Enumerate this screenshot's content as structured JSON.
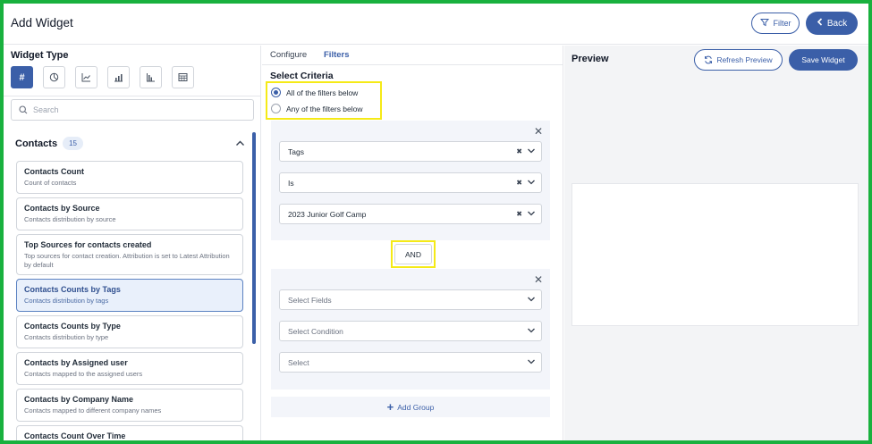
{
  "header": {
    "title": "Add Widget",
    "filter_label": "Filter",
    "back_label": "Back"
  },
  "left_panel": {
    "widget_type_label": "Widget Type",
    "type_icons": [
      "number-icon",
      "pie-chart-icon",
      "line-chart-icon",
      "bar-chart-icon",
      "column-chart-icon",
      "table-icon"
    ],
    "active_type_symbol": "#",
    "search_placeholder": "Search",
    "section": {
      "name": "Contacts",
      "count": "15"
    },
    "widgets": [
      {
        "title": "Contacts Count",
        "desc": "Count of contacts",
        "selected": false
      },
      {
        "title": "Contacts by Source",
        "desc": "Contacts distribution by source",
        "selected": false
      },
      {
        "title": "Top Sources for contacts created",
        "desc": "Top sources for contact creation. Attribution is set to Latest Attribution by default",
        "selected": false
      },
      {
        "title": "Contacts Counts by Tags",
        "desc": "Contacts distribution by tags",
        "selected": true
      },
      {
        "title": "Contacts Counts by Type",
        "desc": "Contacts distribution by type",
        "selected": false
      },
      {
        "title": "Contacts by Assigned user",
        "desc": "Contacts mapped to the assigned users",
        "selected": false
      },
      {
        "title": "Contacts by Company Name",
        "desc": "Contacts mapped to different company names",
        "selected": false
      },
      {
        "title": "Contacts Count Over Time",
        "desc": "",
        "selected": false
      }
    ]
  },
  "middle_panel": {
    "tabs": [
      {
        "label": "Configure",
        "active": false
      },
      {
        "label": "Filters",
        "active": true
      }
    ],
    "select_criteria_label": "Select Criteria",
    "radio_all": "All of the filters below",
    "radio_any": "Any of the filters below",
    "group1": {
      "field": "Tags",
      "condition": "Is",
      "value": "2023 Junior Golf Camp"
    },
    "and_label": "AND",
    "group2": {
      "field_placeholder": "Select Fields",
      "condition_placeholder": "Select Condition",
      "value_placeholder": "Select"
    },
    "add_group_label": "Add Group"
  },
  "right_panel": {
    "title": "Preview",
    "refresh_label": "Refresh Preview",
    "save_label": "Save Widget"
  },
  "colors": {
    "accent": "#3b5fa8",
    "frame_border": "#19b13e",
    "highlight": "#f5ea17"
  }
}
